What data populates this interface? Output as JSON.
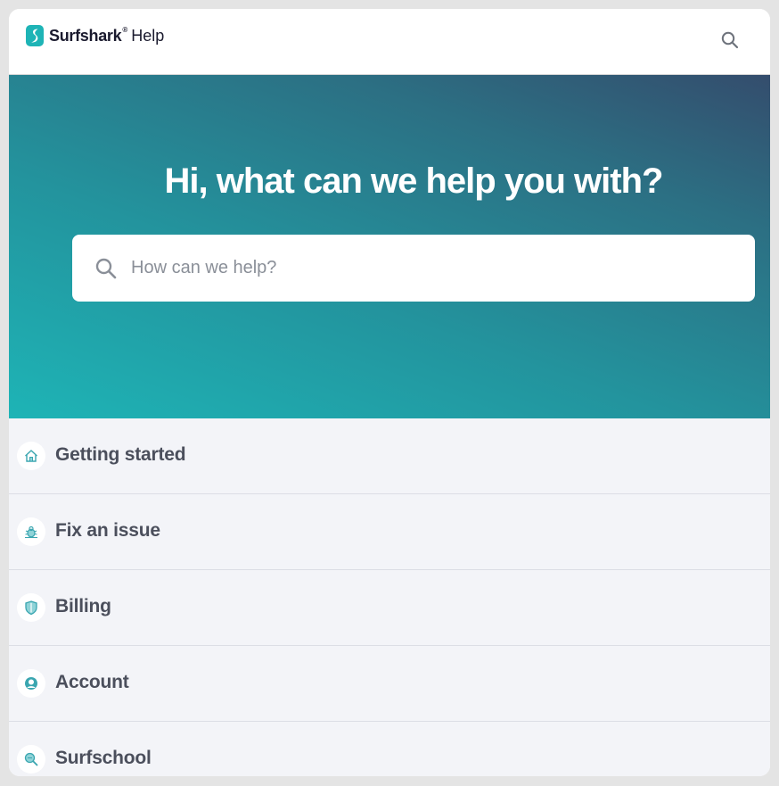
{
  "header": {
    "brand": "Surfshark",
    "registered_mark": "®",
    "section": "Help",
    "search_icon": "search-icon"
  },
  "hero": {
    "title": "Hi, what can we help you with?",
    "search": {
      "placeholder": "How can we help?",
      "value": "",
      "icon": "search-icon"
    }
  },
  "categories": [
    {
      "label": "Getting started",
      "icon": "home-icon"
    },
    {
      "label": "Fix an issue",
      "icon": "bug-icon"
    },
    {
      "label": "Billing",
      "icon": "shield-icon"
    },
    {
      "label": "Account",
      "icon": "user-icon"
    },
    {
      "label": "Surfschool",
      "icon": "magnifier-icon"
    }
  ],
  "colors": {
    "brand_teal": "#1eb4b6",
    "hero_gradient_end": "#344d6d",
    "list_background": "#f3f4f8",
    "label_text": "#4b4f5c",
    "icon_accent": "#3aa6b0"
  }
}
